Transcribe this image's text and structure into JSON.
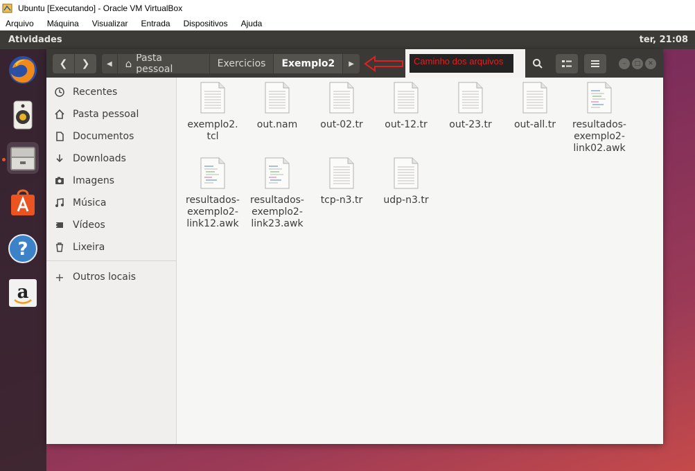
{
  "host": {
    "title": "Ubuntu [Executando] - Oracle VM VirtualBox",
    "menu": [
      "Arquivo",
      "Máquina",
      "Visualizar",
      "Entrada",
      "Dispositivos",
      "Ajuda"
    ]
  },
  "topbar": {
    "activities": "Atividades",
    "clock": "ter, 21:08"
  },
  "dock": {
    "apps": [
      {
        "name": "firefox-icon"
      },
      {
        "name": "rhythmbox-icon"
      },
      {
        "name": "files-icon",
        "running": true
      },
      {
        "name": "software-center-icon"
      },
      {
        "name": "help-icon"
      },
      {
        "name": "amazon-icon"
      }
    ]
  },
  "nautilus": {
    "path": {
      "home": "Pasta pessoal",
      "parent": "Exercicios",
      "current": "Exemplo2"
    },
    "annotation": "Caminho dos arquivos",
    "sidebar": {
      "items": [
        {
          "label": "Recentes",
          "icon": "clock-icon"
        },
        {
          "label": "Pasta pessoal",
          "icon": "home-icon"
        },
        {
          "label": "Documentos",
          "icon": "document-icon"
        },
        {
          "label": "Downloads",
          "icon": "download-icon"
        },
        {
          "label": "Imagens",
          "icon": "camera-icon"
        },
        {
          "label": "Música",
          "icon": "music-icon"
        },
        {
          "label": "Vídeos",
          "icon": "video-icon"
        },
        {
          "label": "Lixeira",
          "icon": "trash-icon"
        }
      ],
      "other": {
        "label": "Outros locais",
        "icon": "plus-icon"
      }
    },
    "files": [
      {
        "name": "exemplo2.\ntcl",
        "kind": "text"
      },
      {
        "name": "out.nam",
        "kind": "text"
      },
      {
        "name": "out-02.tr",
        "kind": "text"
      },
      {
        "name": "out-12.tr",
        "kind": "text"
      },
      {
        "name": "out-23.tr",
        "kind": "text"
      },
      {
        "name": "out-all.tr",
        "kind": "text"
      },
      {
        "name": "resultados-\nexemplo2-\nlink02.awk",
        "kind": "script"
      },
      {
        "name": "resultados-\nexemplo2-\nlink12.awk",
        "kind": "script"
      },
      {
        "name": "resultados-\nexemplo2-\nlink23.awk",
        "kind": "script"
      },
      {
        "name": "tcp-n3.tr",
        "kind": "text"
      },
      {
        "name": "udp-n3.tr",
        "kind": "text"
      }
    ]
  },
  "colors": {
    "ubuntu_orange": "#e95420",
    "annotation_red": "#e02020",
    "headerbar": "#3a3935"
  }
}
